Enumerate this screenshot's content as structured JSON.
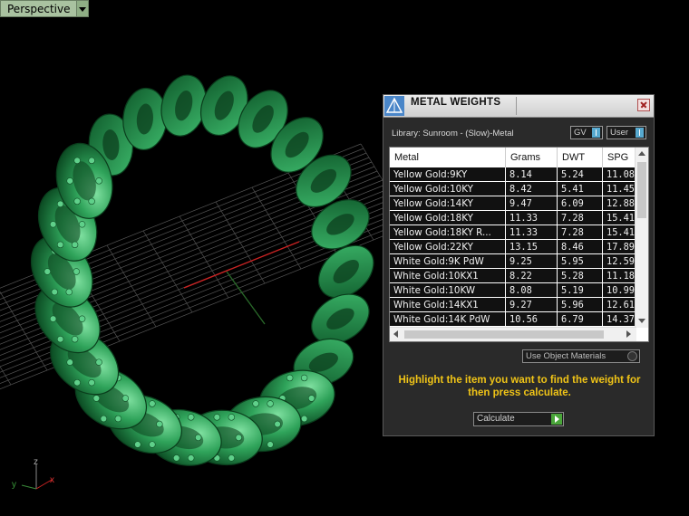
{
  "viewport": {
    "label": "Perspective"
  },
  "axes": {
    "x": "x",
    "y": "y",
    "z": "z"
  },
  "panel": {
    "title": "METAL WEIGHTS",
    "library": "Library: Sunroom - (Slow)-Metal",
    "gv_option": "GV",
    "user_option": "User",
    "columns": [
      "Metal",
      "Grams",
      "DWT",
      "SPG"
    ],
    "rows": [
      [
        "Yellow Gold:9KY",
        "8.14",
        "5.24",
        "11.08"
      ],
      [
        "Yellow Gold:10KY",
        "8.42",
        "5.41",
        "11.45"
      ],
      [
        "Yellow Gold:14KY",
        "9.47",
        "6.09",
        "12.88"
      ],
      [
        "Yellow Gold:18KY",
        "11.33",
        "7.28",
        "15.41"
      ],
      [
        "Yellow Gold:18KY R...",
        "11.33",
        "7.28",
        "15.41"
      ],
      [
        "Yellow Gold:22KY",
        "13.15",
        "8.46",
        "17.89"
      ],
      [
        "White Gold:9K PdW",
        "9.25",
        "5.95",
        "12.59"
      ],
      [
        "White Gold:10KX1",
        "8.22",
        "5.28",
        "11.18"
      ],
      [
        "White Gold:10KW",
        "8.08",
        "5.19",
        "10.99"
      ],
      [
        "White Gold:14KX1",
        "9.27",
        "5.96",
        "12.61"
      ],
      [
        "White Gold:14K PdW",
        "10.56",
        "6.79",
        "14.37"
      ]
    ],
    "use_object_materials": "Use Object Materials",
    "hint": "Highlight the item you want to find the weight for then press calculate.",
    "calculate": "Calculate"
  },
  "colors": {
    "model_green": "#2e9b52",
    "hint_text": "#f0c417",
    "accent_blue": "#57a9cf",
    "go_green": "#4aa63a"
  }
}
